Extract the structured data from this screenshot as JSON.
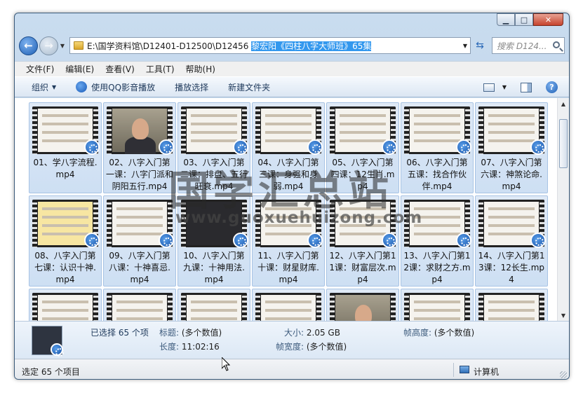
{
  "window": {
    "caption_buttons": [
      "minimize",
      "maximize",
      "close"
    ],
    "close_glyph": "✕",
    "minimize_glyph": "▁",
    "maximize_glyph": "□"
  },
  "nav": {
    "back_glyph": "←",
    "forward_glyph": "→",
    "address_path_plain": "E:\\国学资料馆\\D12401-D12500\\D12456 ",
    "address_path_selected": "黎宏阳《四柱八字大师班》65集",
    "search_placeholder": "搜索 D124...",
    "refresh_glyph": "⇆"
  },
  "menubar": {
    "items": [
      "文件(F)",
      "编辑(E)",
      "查看(V)",
      "工具(T)",
      "帮助(H)"
    ]
  },
  "toolbar": {
    "organize_label": "组织",
    "qq_play_label": "使用QQ影音播放",
    "play_selection_label": "播放选择",
    "new_folder_label": "新建文件夹",
    "help_glyph": "?"
  },
  "files": [
    {
      "name": "01、学八字流程.mp4",
      "thumb": "light"
    },
    {
      "name": "02、八字入门第一课：八字门派和阴阳五行.mp4",
      "thumb": "person"
    },
    {
      "name": "03、八字入门第二课：排盘、五行旺衰.mp4",
      "thumb": "light"
    },
    {
      "name": "04、八字入门第三课：身强和身弱.mp4",
      "thumb": "light"
    },
    {
      "name": "05、八字入门第四课：12生肖.mp4",
      "thumb": "light"
    },
    {
      "name": "06、八字入门第五课：找合作伙伴.mp4",
      "thumb": "light"
    },
    {
      "name": "07、八字入门第六课：神煞论命.mp4",
      "thumb": "light"
    },
    {
      "name": "08、八字入门第七课：认识十神.mp4",
      "thumb": "yellow"
    },
    {
      "name": "09、八字入门第八课：十神喜忌.mp4",
      "thumb": "light"
    },
    {
      "name": "10、八字入门第九课：十神用法.mp4",
      "thumb": "dark"
    },
    {
      "name": "11、八字入门第十课：财星财库.mp4",
      "thumb": "light"
    },
    {
      "name": "12、八字入门第11课：财富层次.mp4",
      "thumb": "light"
    },
    {
      "name": "13、八字入门第12课：求财之方.mp4",
      "thumb": "light"
    },
    {
      "name": "14、八字入门第13课：12长生.mp4",
      "thumb": "light"
    },
    {
      "name": "",
      "thumb": "light"
    },
    {
      "name": "",
      "thumb": "light"
    },
    {
      "name": "",
      "thumb": "light"
    },
    {
      "name": "",
      "thumb": "light"
    },
    {
      "name": "",
      "thumb": "person"
    },
    {
      "name": "",
      "thumb": "light"
    },
    {
      "name": "",
      "thumb": "light"
    }
  ],
  "watermark": {
    "text": "国学汇总站",
    "url": "www.guoxuehuizong.com"
  },
  "details": {
    "selected": "已选择 65 个项",
    "title_label": "标题:",
    "title_value": "(多个数值)",
    "length_label": "长度:",
    "length_value": "11:02:16",
    "size_label": "大小:",
    "size_value": "2.05 GB",
    "frame_width_label": "帧宽度:",
    "frame_width_value": "(多个数值)",
    "frame_height_label": "帧高度:",
    "frame_height_value": "(多个数值)"
  },
  "status": {
    "selection": "选定 65 个项目",
    "location": "计算机"
  }
}
